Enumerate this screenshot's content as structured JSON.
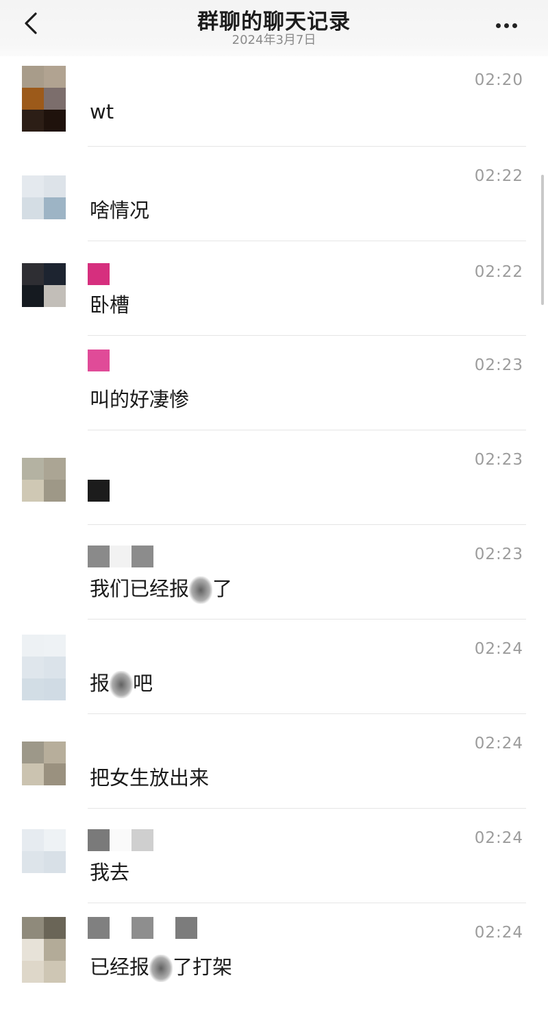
{
  "header": {
    "title": "群聊的聊天记录",
    "date": "2024年3月7日"
  },
  "messages": [
    {
      "time": "02:20",
      "text": "wt"
    },
    {
      "time": "02:22",
      "text": "啥情况"
    },
    {
      "time": "02:22",
      "text": "卧槽"
    },
    {
      "time": "02:23",
      "text": "叫的好凄惨"
    },
    {
      "time": "02:23",
      "text": ""
    },
    {
      "time": "02:23",
      "text_a": "我们已经报",
      "text_b": "了"
    },
    {
      "time": "02:24",
      "text_a": "报",
      "text_b": "吧"
    },
    {
      "time": "02:24",
      "text": "把女生放出来"
    },
    {
      "time": "02:24",
      "text": "我去"
    },
    {
      "time": "02:24",
      "text_a": "已经报",
      "text_b": "了打架"
    }
  ],
  "icons": {
    "back": "chevron-left-icon",
    "more": "more-dots-icon"
  },
  "colors": {
    "accent_pink": "#d62f7e",
    "separator": "#e5e5e5"
  }
}
